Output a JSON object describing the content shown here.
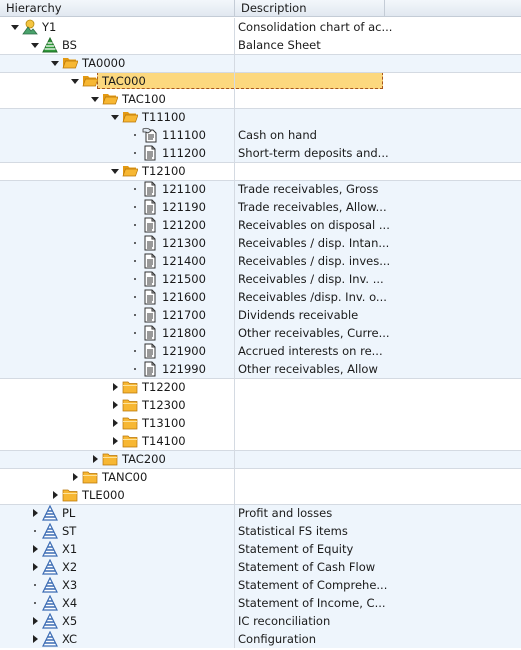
{
  "header": {
    "hierarchy": "Hierarchy",
    "description": "Description"
  },
  "rows": [
    {
      "id": "Y1",
      "level": 0,
      "toggle": "down",
      "icon": "consolidation",
      "desc": "Consolidation chart of ac..."
    },
    {
      "id": "BS",
      "level": 1,
      "toggle": "down",
      "icon": "hierarchy-green",
      "desc": "Balance Sheet"
    },
    {
      "id": "TA0000",
      "level": 2,
      "toggle": "down",
      "icon": "folder-open",
      "desc": ""
    },
    {
      "id": "TAC000",
      "level": 3,
      "toggle": "down",
      "icon": "folder-open",
      "desc": "",
      "selected": true
    },
    {
      "id": "TAC100",
      "level": 4,
      "toggle": "down",
      "icon": "folder-open",
      "desc": ""
    },
    {
      "id": "T11100",
      "level": 5,
      "toggle": "down",
      "icon": "folder-open",
      "desc": ""
    },
    {
      "id": "111100",
      "level": 6,
      "toggle": "dot",
      "icon": "document-hand",
      "desc": "Cash on hand"
    },
    {
      "id": "111200",
      "level": 6,
      "toggle": "dot",
      "icon": "document",
      "desc": "Short-term deposits and..."
    },
    {
      "id": "T12100",
      "level": 5,
      "toggle": "down",
      "icon": "folder-open",
      "desc": ""
    },
    {
      "id": "121100",
      "level": 6,
      "toggle": "dot",
      "icon": "document",
      "desc": "Trade receivables, Gross"
    },
    {
      "id": "121190",
      "level": 6,
      "toggle": "dot",
      "icon": "document",
      "desc": "Trade receivables, Allow..."
    },
    {
      "id": "121200",
      "level": 6,
      "toggle": "dot",
      "icon": "document",
      "desc": "Receivables on disposal ..."
    },
    {
      "id": "121300",
      "level": 6,
      "toggle": "dot",
      "icon": "document",
      "desc": "Receivables / disp. Intan..."
    },
    {
      "id": "121400",
      "level": 6,
      "toggle": "dot",
      "icon": "document",
      "desc": "Receivables / disp. inves..."
    },
    {
      "id": "121500",
      "level": 6,
      "toggle": "dot",
      "icon": "document",
      "desc": "Receivables / disp. Inv. ..."
    },
    {
      "id": "121600",
      "level": 6,
      "toggle": "dot",
      "icon": "document",
      "desc": "Receivables /disp. Inv. o..."
    },
    {
      "id": "121700",
      "level": 6,
      "toggle": "dot",
      "icon": "document",
      "desc": "Dividends receivable"
    },
    {
      "id": "121800",
      "level": 6,
      "toggle": "dot",
      "icon": "document",
      "desc": "Other receivables, Curre..."
    },
    {
      "id": "121900",
      "level": 6,
      "toggle": "dot",
      "icon": "document",
      "desc": "Accrued interests on re..."
    },
    {
      "id": "121990",
      "level": 6,
      "toggle": "dot",
      "icon": "document",
      "desc": "Other receivables, Allow"
    },
    {
      "id": "T12200",
      "level": 5,
      "toggle": "right",
      "icon": "folder",
      "desc": ""
    },
    {
      "id": "T12300",
      "level": 5,
      "toggle": "right",
      "icon": "folder",
      "desc": ""
    },
    {
      "id": "T13100",
      "level": 5,
      "toggle": "right",
      "icon": "folder",
      "desc": ""
    },
    {
      "id": "T14100",
      "level": 5,
      "toggle": "right",
      "icon": "folder",
      "desc": ""
    },
    {
      "id": "TAC200",
      "level": 4,
      "toggle": "right",
      "icon": "folder",
      "desc": ""
    },
    {
      "id": "TANC00",
      "level": 3,
      "toggle": "right",
      "icon": "folder",
      "desc": ""
    },
    {
      "id": "TLE000",
      "level": 2,
      "toggle": "right",
      "icon": "folder",
      "desc": ""
    },
    {
      "id": "PL",
      "level": 1,
      "toggle": "right",
      "icon": "hierarchy-blue",
      "desc": "Profit and losses"
    },
    {
      "id": "ST",
      "level": 1,
      "toggle": "dot",
      "icon": "hierarchy-blue",
      "desc": "Statistical FS items"
    },
    {
      "id": "X1",
      "level": 1,
      "toggle": "right",
      "icon": "hierarchy-blue",
      "desc": "Statement of Equity"
    },
    {
      "id": "X2",
      "level": 1,
      "toggle": "right",
      "icon": "hierarchy-blue",
      "desc": "Statement of Cash Flow"
    },
    {
      "id": "X3",
      "level": 1,
      "toggle": "dot",
      "icon": "hierarchy-blue",
      "desc": "Statement of Comprehe..."
    },
    {
      "id": "X4",
      "level": 1,
      "toggle": "dot",
      "icon": "hierarchy-blue",
      "desc": "Statement of Income, C..."
    },
    {
      "id": "X5",
      "level": 1,
      "toggle": "right",
      "icon": "hierarchy-blue",
      "desc": "IC reconciliation"
    },
    {
      "id": "XC",
      "level": 1,
      "toggle": "right",
      "icon": "hierarchy-blue",
      "desc": "Configuration"
    }
  ],
  "colors": {
    "selection": "#fcd87e",
    "selection_border": "#a8561c",
    "band": "#eef5fc",
    "folder": "#f7b733",
    "hierarchy_blue": "#3c6cb4",
    "hierarchy_green": "#2f9a3a"
  }
}
